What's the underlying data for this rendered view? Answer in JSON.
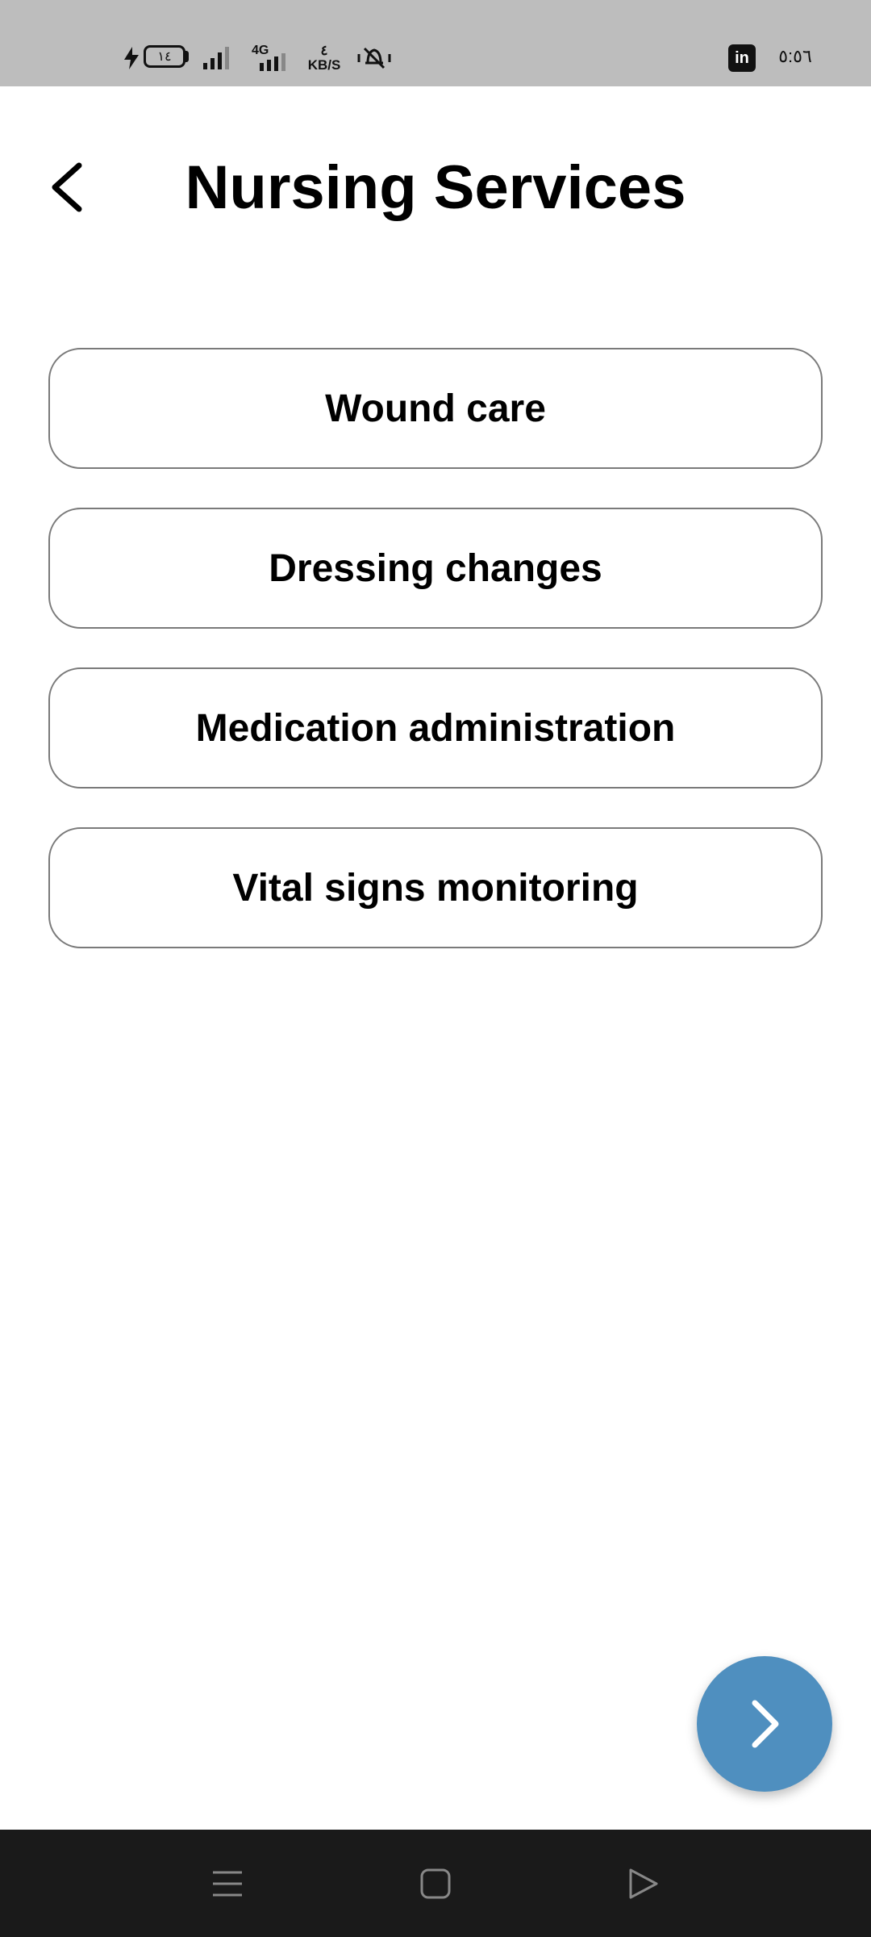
{
  "status_bar": {
    "battery_level": "١٤",
    "network": "4G",
    "speed_value": "٤",
    "speed_unit": "KB/S",
    "time": "٥:٥٦",
    "linkedin_label": "in"
  },
  "header": {
    "title": "Nursing Services"
  },
  "options": [
    {
      "label": "Wound care"
    },
    {
      "label": "Dressing changes"
    },
    {
      "label": "Medication administration"
    },
    {
      "label": "Vital signs monitoring"
    }
  ],
  "colors": {
    "fab": "#4f8fbf",
    "status_bar": "#bdbdbd",
    "nav_bar": "#1a1a1a",
    "button_border": "#7a7a7a"
  },
  "icons": {
    "back": "chevron-left-icon",
    "fab": "chevron-right-icon",
    "nav": [
      "menu-icon",
      "home-icon",
      "back-triangle-icon"
    ]
  }
}
